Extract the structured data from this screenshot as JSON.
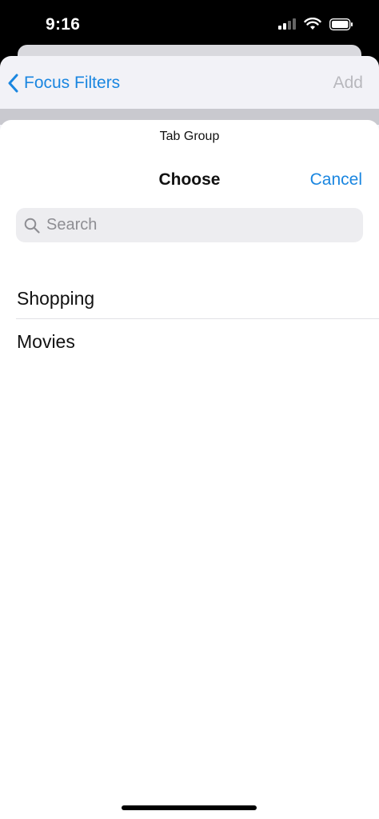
{
  "status_bar": {
    "time": "9:16"
  },
  "nav": {
    "back_label": "Focus Filters",
    "add_label": "Add"
  },
  "sheet": {
    "subtitle": "Tab Group",
    "title": "Choose",
    "cancel_label": "Cancel",
    "search_placeholder": "Search",
    "items": [
      {
        "label": "Shopping"
      },
      {
        "label": "Movies"
      }
    ]
  },
  "colors": {
    "accent": "#1a86e0",
    "disabled": "#b8b8bd",
    "background": "#f2f2f7"
  }
}
